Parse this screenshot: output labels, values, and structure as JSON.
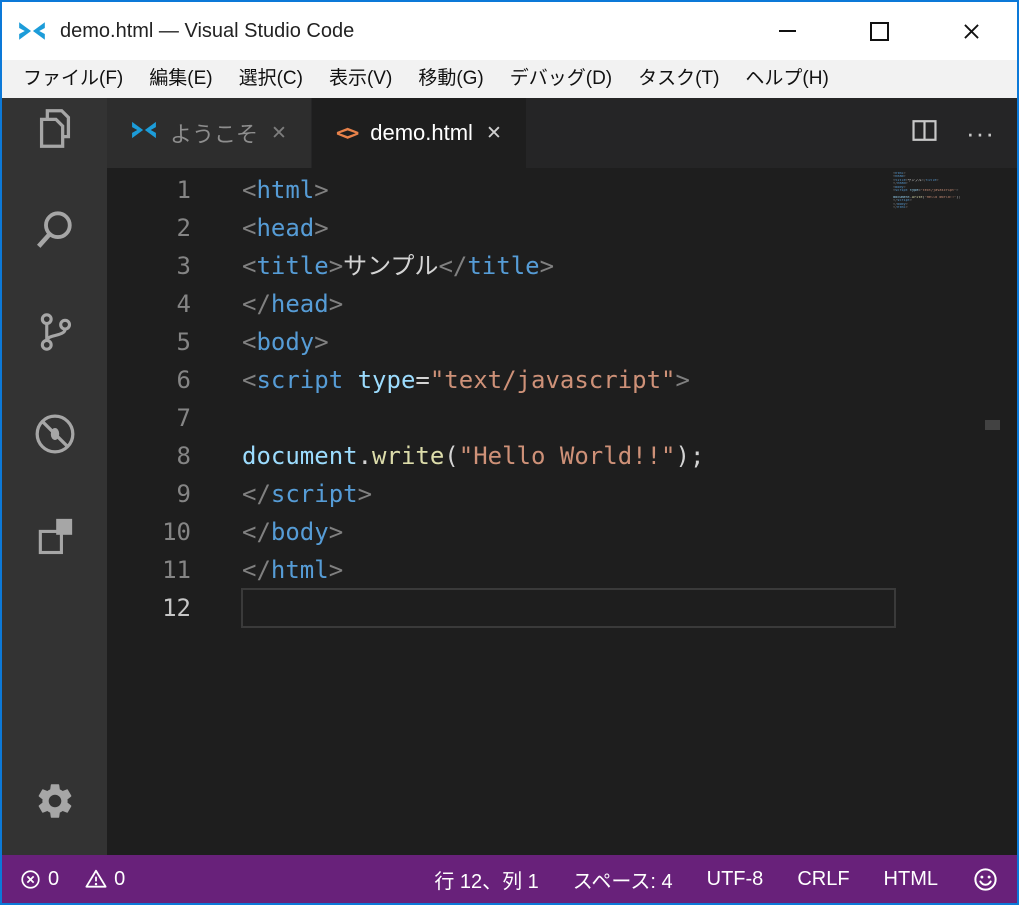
{
  "window": {
    "title": "demo.html — Visual Studio Code"
  },
  "colors": {
    "window_border_blue": "#0c79d8",
    "vscode_logo_blue": "#1c9cd9",
    "html_icon_orange": "#e8824a",
    "statusbar_purple": "#68217a",
    "editor_background": "#1e1e1e",
    "activitybar_background": "#333333"
  },
  "menu": {
    "items": [
      "ファイル(F)",
      "編集(E)",
      "選択(C)",
      "表示(V)",
      "移動(G)",
      "デバッグ(D)",
      "タスク(T)",
      "ヘルプ(H)"
    ]
  },
  "activity_bar": {
    "icons": [
      "explorer",
      "search",
      "source-control",
      "debug-disabled",
      "extensions"
    ],
    "bottom_icons": [
      "settings-gear"
    ]
  },
  "tab_bar": {
    "tabs": [
      {
        "label": "ようこそ",
        "icon": "vscode-logo",
        "close_glyph": "✕",
        "active": false
      },
      {
        "label": "demo.html",
        "icon": "html-file",
        "icon_glyph": "<>",
        "close_glyph": "✕",
        "active": true
      }
    ],
    "actions": {
      "split_editor": "split-editor-icon",
      "more_glyph": "···"
    }
  },
  "editor": {
    "cursor": {
      "line": 12,
      "col": 1
    },
    "lines": [
      {
        "num": 1,
        "tokens": [
          {
            "t": "<",
            "c": "p"
          },
          {
            "t": "html",
            "c": "tag"
          },
          {
            "t": ">",
            "c": "p"
          }
        ]
      },
      {
        "num": 2,
        "tokens": [
          {
            "t": "<",
            "c": "p"
          },
          {
            "t": "head",
            "c": "tag"
          },
          {
            "t": ">",
            "c": "p"
          }
        ]
      },
      {
        "num": 3,
        "tokens": [
          {
            "t": "<",
            "c": "p"
          },
          {
            "t": "title",
            "c": "tag"
          },
          {
            "t": ">",
            "c": "p"
          },
          {
            "t": "サンプル",
            "c": "text"
          },
          {
            "t": "</",
            "c": "p"
          },
          {
            "t": "title",
            "c": "tag"
          },
          {
            "t": ">",
            "c": "p"
          }
        ]
      },
      {
        "num": 4,
        "tokens": [
          {
            "t": "</",
            "c": "p"
          },
          {
            "t": "head",
            "c": "tag"
          },
          {
            "t": ">",
            "c": "p"
          }
        ]
      },
      {
        "num": 5,
        "tokens": [
          {
            "t": "<",
            "c": "p"
          },
          {
            "t": "body",
            "c": "tag"
          },
          {
            "t": ">",
            "c": "p"
          }
        ]
      },
      {
        "num": 6,
        "tokens": [
          {
            "t": "<",
            "c": "p"
          },
          {
            "t": "script",
            "c": "tag"
          },
          {
            "t": " ",
            "c": "text"
          },
          {
            "t": "type",
            "c": "attr"
          },
          {
            "t": "=",
            "c": "text"
          },
          {
            "t": "\"text/javascript\"",
            "c": "str"
          },
          {
            "t": ">",
            "c": "p"
          }
        ]
      },
      {
        "num": 7,
        "tokens": []
      },
      {
        "num": 8,
        "tokens": [
          {
            "t": "document",
            "c": "var"
          },
          {
            "t": ".",
            "c": "text"
          },
          {
            "t": "write",
            "c": "fn"
          },
          {
            "t": "(",
            "c": "text"
          },
          {
            "t": "\"Hello World!!\"",
            "c": "str"
          },
          {
            "t": ")",
            "c": "text"
          },
          {
            "t": ";",
            "c": "text"
          }
        ]
      },
      {
        "num": 9,
        "tokens": [
          {
            "t": "</",
            "c": "p"
          },
          {
            "t": "script",
            "c": "tag"
          },
          {
            "t": ">",
            "c": "p"
          }
        ]
      },
      {
        "num": 10,
        "tokens": [
          {
            "t": "</",
            "c": "p"
          },
          {
            "t": "body",
            "c": "tag"
          },
          {
            "t": ">",
            "c": "p"
          }
        ]
      },
      {
        "num": 11,
        "tokens": [
          {
            "t": "</",
            "c": "p"
          },
          {
            "t": "html",
            "c": "tag"
          },
          {
            "t": ">",
            "c": "p"
          }
        ]
      },
      {
        "num": 12,
        "tokens": []
      }
    ]
  },
  "status_bar": {
    "errors": "0",
    "warnings": "0",
    "line_col": "行 12、列 1",
    "indent": "スペース: 4",
    "encoding": "UTF-8",
    "eol": "CRLF",
    "language": "HTML"
  }
}
